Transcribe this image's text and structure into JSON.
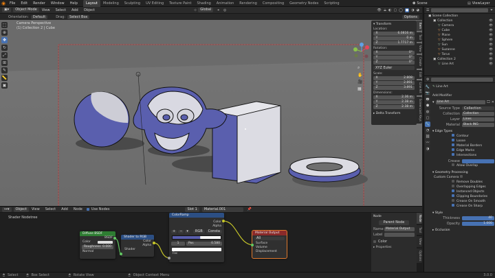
{
  "menubar": {
    "items": [
      "File",
      "Edit",
      "Render",
      "Window",
      "Help"
    ],
    "workspaces": [
      "Layout",
      "Modeling",
      "Sculpting",
      "UV Editing",
      "Texture Paint",
      "Shading",
      "Animation",
      "Rendering",
      "Compositing",
      "Geometry Nodes",
      "Scripting"
    ],
    "active_workspace": "Layout",
    "scene": "Scene",
    "view_layer": "ViewLayer"
  },
  "viewport_header": {
    "mode": "Object Mode",
    "menus": [
      "View",
      "Select",
      "Add",
      "Object"
    ],
    "orientation_label": "Orientation:",
    "orientation": "Default",
    "drag_label": "Drag:",
    "drag": "Select Box",
    "transform_orientation": "Global",
    "options": "Options"
  },
  "viewport_overlay": {
    "line1": "Camera Perspective",
    "line2": "(1) Collection 2 | Cube"
  },
  "npanel": {
    "title": "Transform",
    "location_label": "Location:",
    "location": [
      {
        "axis": "X",
        "value": "6.0816 m"
      },
      {
        "axis": "Y",
        "value": "0 m"
      },
      {
        "axis": "Z",
        "value": "1.7717 m"
      }
    ],
    "rotation_label": "Rotation:",
    "rotation": [
      {
        "axis": "X",
        "value": "0°"
      },
      {
        "axis": "Y",
        "value": "0°"
      },
      {
        "axis": "Z",
        "value": "0°"
      }
    ],
    "rotation_mode": "XYZ Euler",
    "scale_label": "Scale:",
    "scale": [
      {
        "axis": "X",
        "value": "2.808"
      },
      {
        "axis": "Y",
        "value": "2.891"
      },
      {
        "axis": "Z",
        "value": "3.891"
      }
    ],
    "dimensions_label": "Dimensions:",
    "dimensions": [
      {
        "axis": "X",
        "value": "2.36 m"
      },
      {
        "axis": "Y",
        "value": "2.38 m"
      },
      {
        "axis": "Z",
        "value": "2.38 m"
      }
    ],
    "delta_label": "Delta Transform",
    "tabs": [
      "Item",
      "Tool",
      "View",
      "Create",
      "Edit",
      "Line Art",
      "Screencast Keys"
    ]
  },
  "node_header": {
    "editor_type": "Object",
    "menus": [
      "View",
      "Select",
      "Add",
      "Node"
    ],
    "use_nodes": "Use Nodes",
    "slot": "Slot 1",
    "material": "Material.001"
  },
  "node_editor": {
    "breadcrumb": "Shader Nodetree",
    "nodes": {
      "diffuse": {
        "title": "Diffuse BSDF",
        "out": "BSDF",
        "in_color": "Color",
        "roughness_label": "Roughness",
        "roughness": "0.000",
        "normal": "Normal"
      },
      "shader_rgb": {
        "title": "Shader to RGB",
        "out_color": "Color",
        "out_alpha": "Alpha",
        "in": "Shader"
      },
      "colorramp": {
        "title": "ColorRamp",
        "out_color": "Color",
        "out_alpha": "Alpha",
        "mode": "RGB",
        "interp": "Consta",
        "index": "1",
        "pos_label": "Pos",
        "pos": "0.580",
        "in": "Fac"
      },
      "output": {
        "title": "Material Output",
        "target": "All",
        "surface": "Surface",
        "volume": "Volume",
        "displacement": "Displacement"
      }
    },
    "side_panel": {
      "title": "Node",
      "name_btn": "Parent Node",
      "name_label": "Name",
      "name": "Material Output",
      "label_label": "Label",
      "color_label": "Color",
      "properties_label": "Properties",
      "tabs": [
        "Node",
        "Tool",
        "View",
        "Options"
      ]
    }
  },
  "outliner": {
    "title": "Scene Collection",
    "items": [
      {
        "name": "Collection",
        "level": 1,
        "color": "#d9d9d9"
      },
      {
        "name": "Camera",
        "level": 2,
        "color": "#9fc0a0"
      },
      {
        "name": "Cube",
        "level": 2,
        "color": "#e39a5a"
      },
      {
        "name": "Plane",
        "level": 2,
        "color": "#e39a5a"
      },
      {
        "name": "Sphere",
        "level": 2,
        "color": "#e39a5a"
      },
      {
        "name": "Sun",
        "level": 2,
        "color": "#9fc0a0"
      },
      {
        "name": "Suzanne",
        "level": 2,
        "color": "#e39a5a"
      },
      {
        "name": "Torus",
        "level": 2,
        "color": "#e39a5a"
      },
      {
        "name": "Collection 2",
        "level": 1,
        "color": "#d9d9d9"
      },
      {
        "name": "Line Art",
        "level": 2,
        "color": "#9fc0a0"
      }
    ]
  },
  "properties": {
    "object": "Line Art",
    "add_modifier": "Add Modifier",
    "modifier_name": "Line Art",
    "source_type_label": "Source Type",
    "source_type": "Collection",
    "collection_label": "Collection",
    "collection": "Collection",
    "layer_label": "Layer",
    "layer": "Lines",
    "material_label": "Material",
    "material": "Black ING",
    "edge_types": "Edge Types",
    "edges": [
      {
        "label": "Contour",
        "on": true
      },
      {
        "label": "Loose",
        "on": true
      },
      {
        "label": "Material Borders",
        "on": true
      },
      {
        "label": "Edge Marks",
        "on": true
      },
      {
        "label": "Intersections",
        "on": true
      }
    ],
    "crease_label": "Crease",
    "allow_overlap": "Allow Overlap",
    "geometry_processing": "Geometry Processing",
    "custom_camera": "Custom Camera",
    "geo_opts": [
      {
        "label": "Remove Doubles",
        "on": false
      },
      {
        "label": "Overlapping Edges",
        "on": false
      },
      {
        "label": "Instanced Objects",
        "on": true
      },
      {
        "label": "Clipping Boundaries",
        "on": true
      },
      {
        "label": "Crease On Smooth",
        "on": false
      },
      {
        "label": "Crease On Sharp",
        "on": true
      }
    ],
    "style": "Style",
    "thickness_label": "Thickness",
    "thickness": "40",
    "opacity_label": "Opacity",
    "opacity": "1.000",
    "occlusion": "Occlusion"
  },
  "statusbar": {
    "items": [
      "Select",
      "Box Select",
      "Rotate View",
      "Object Context Menu"
    ],
    "version": "3.0.0"
  },
  "colors": {
    "accent": "#4772b3",
    "object_shade": "#5a5fae",
    "floor": "#707070",
    "sky": "#6b6b6b"
  }
}
